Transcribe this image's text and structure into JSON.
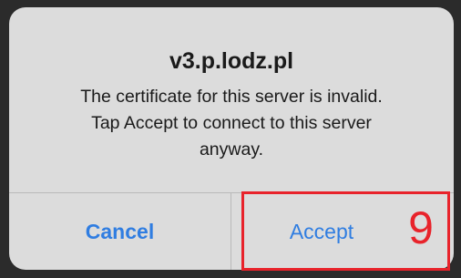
{
  "alert": {
    "title": "v3.p.lodz.pl",
    "message_lines": [
      "The certificate for this server is invalid.",
      "Tap Accept to connect to this server",
      "anyway."
    ],
    "buttons": {
      "cancel_label": "Cancel",
      "accept_label": "Accept"
    }
  },
  "annotation": {
    "step_number": "9",
    "color": "#e8232b"
  },
  "colors": {
    "button_text": "#2f7de1",
    "dialog_background": "#dcdcdc",
    "backdrop": "#2b2b2b"
  }
}
